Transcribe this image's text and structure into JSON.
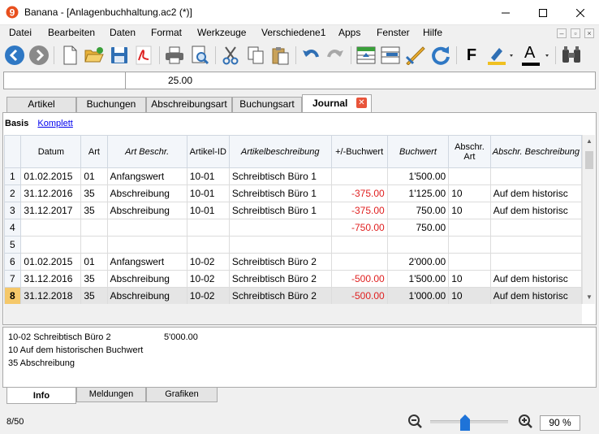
{
  "window": {
    "title": "Banana - [Anlagenbuchhaltung.ac2 (*)]"
  },
  "menu": [
    "Datei",
    "Bearbeiten",
    "Daten",
    "Format",
    "Werkzeuge",
    "Verschiedene1",
    "Apps",
    "Fenster",
    "Hilfe"
  ],
  "toolbar": {
    "bold_label": "F",
    "font_color_label": "A"
  },
  "cellbar": {
    "value": "25.00"
  },
  "tabs": [
    {
      "label": "Artikel"
    },
    {
      "label": "Buchungen"
    },
    {
      "label": "Abschreibungsart"
    },
    {
      "label": "Buchungsart"
    },
    {
      "label": "Journal",
      "active": true
    }
  ],
  "views": {
    "active": "Basis",
    "other": "Komplett"
  },
  "columns": [
    {
      "label": "Datum",
      "italic": false
    },
    {
      "label": "Art",
      "italic": false
    },
    {
      "label": "Art Beschr.",
      "italic": true
    },
    {
      "label": "Artikel-ID",
      "italic": false
    },
    {
      "label": "Artikelbeschreibung",
      "italic": true
    },
    {
      "label": "+/-Buchwert",
      "italic": false
    },
    {
      "label": "Buchwert",
      "italic": true
    },
    {
      "label": "Abschr. Art",
      "italic": false
    },
    {
      "label": "Abschr. Beschreibung",
      "italic": true
    }
  ],
  "rows": [
    {
      "n": "1",
      "datum": "01.02.2015",
      "art": "01",
      "artbeschr": "Anfangswert",
      "id": "10-01",
      "beschr": "Schreibtisch Büro 1",
      "plusminus": "",
      "buchwert": "1'500.00",
      "abschrart": "",
      "abschrbeschr": ""
    },
    {
      "n": "2",
      "datum": "31.12.2016",
      "art": "35",
      "artbeschr": "Abschreibung",
      "id": "10-01",
      "beschr": "Schreibtisch Büro 1",
      "plusminus": "-375.00",
      "buchwert": "1'125.00",
      "abschrart": "10",
      "abschrbeschr": "Auf dem historisc"
    },
    {
      "n": "3",
      "datum": "31.12.2017",
      "art": "35",
      "artbeschr": "Abschreibung",
      "id": "10-01",
      "beschr": "Schreibtisch Büro 1",
      "plusminus": "-375.00",
      "buchwert": "750.00",
      "abschrart": "10",
      "abschrbeschr": "Auf dem historisc"
    },
    {
      "n": "4",
      "datum": "",
      "art": "",
      "artbeschr": "",
      "id": "",
      "beschr": "",
      "plusminus": "-750.00",
      "buchwert": "750.00",
      "abschrart": "",
      "abschrbeschr": ""
    },
    {
      "n": "5",
      "datum": "",
      "art": "",
      "artbeschr": "",
      "id": "",
      "beschr": "",
      "plusminus": "",
      "buchwert": "",
      "abschrart": "",
      "abschrbeschr": ""
    },
    {
      "n": "6",
      "datum": "01.02.2015",
      "art": "01",
      "artbeschr": "Anfangswert",
      "id": "10-02",
      "beschr": "Schreibtisch Büro 2",
      "plusminus": "",
      "buchwert": "2'000.00",
      "abschrart": "",
      "abschrbeschr": ""
    },
    {
      "n": "7",
      "datum": "31.12.2016",
      "art": "35",
      "artbeschr": "Abschreibung",
      "id": "10-02",
      "beschr": "Schreibtisch Büro 2",
      "plusminus": "-500.00",
      "buchwert": "1'500.00",
      "abschrart": "10",
      "abschrbeschr": "Auf dem historisc"
    },
    {
      "n": "8",
      "datum": "31.12.2018",
      "art": "35",
      "artbeschr": "Abschreibung",
      "id": "10-02",
      "beschr": "Schreibtisch Büro 2",
      "plusminus": "-500.00",
      "buchwert": "1'000.00",
      "abschrart": "10",
      "abschrbeschr": "Auf dem historisc",
      "selected": true
    }
  ],
  "info": {
    "line1": "10-02 Schreibtisch Büro 2",
    "line1_amount": "5'000.00",
    "line2": "10 Auf dem historischen Buchwert",
    "line3": "35 Abschreibung"
  },
  "bottom_tabs": [
    {
      "label": "Info",
      "active": true
    },
    {
      "label": "Meldungen"
    },
    {
      "label": "Grafiken"
    }
  ],
  "status": {
    "rowcount": "8/50",
    "zoom": "90 %",
    "zoom_level": 0.45
  },
  "colors": {
    "negative": "#e02020",
    "selected_rownum": "#f5c86a",
    "link": "#0000ee",
    "tab_close": "#e8543a"
  }
}
